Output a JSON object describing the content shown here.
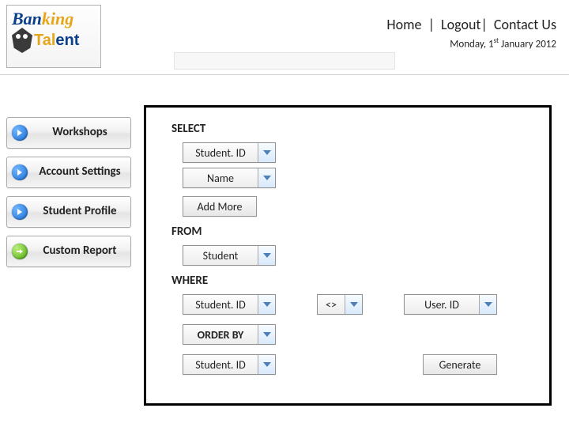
{
  "header": {
    "logo": {
      "part1": "Ban",
      "part2": "king",
      "part3": "Tal",
      "part4": "ent"
    },
    "links": {
      "home": "Home",
      "logout": "Logout",
      "contact": "Contact Us"
    },
    "date_prefix": "Monday, 1",
    "date_sup": "st",
    "date_suffix": " January 2012"
  },
  "sidebar": {
    "items": [
      {
        "label": "Workshops",
        "active": false
      },
      {
        "label": "Account Settings",
        "active": false
      },
      {
        "label": "Student Profile",
        "active": false
      },
      {
        "label": "Custom Report",
        "active": true
      }
    ]
  },
  "query": {
    "kw_select": "SELECT",
    "fields": [
      "Student. ID",
      "Name"
    ],
    "add_more": "Add More",
    "kw_from": "FROM",
    "from_table": "Student",
    "kw_where": "WHERE",
    "where_left": "Student. ID",
    "where_op": "<>",
    "where_right": "User. ID",
    "kw_orderby_label": "ORDER BY",
    "orderby_field": "Student. ID",
    "generate": "Generate"
  }
}
